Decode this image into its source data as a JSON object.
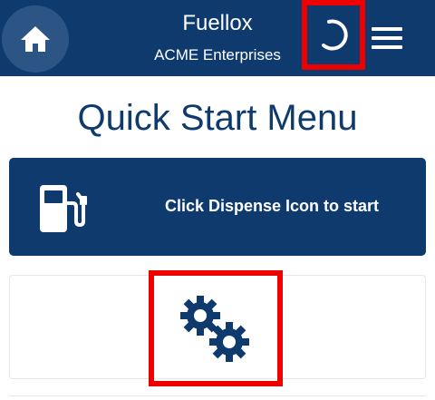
{
  "header": {
    "app_name": "Fuellox",
    "company": "ACME Enterprises",
    "home_icon": "home-icon",
    "loading_icon": "loading-spinner-icon",
    "menu_icon": "hamburger-menu-icon",
    "bar_color": "#0f3a6e",
    "highlight_color": "#ee0000"
  },
  "main": {
    "title": "Quick Start Menu",
    "dispense_card": {
      "label": "Click Dispense Icon to start",
      "icon": "fuel-pump-icon"
    },
    "settings_card": {
      "icon": "gears-icon"
    }
  }
}
